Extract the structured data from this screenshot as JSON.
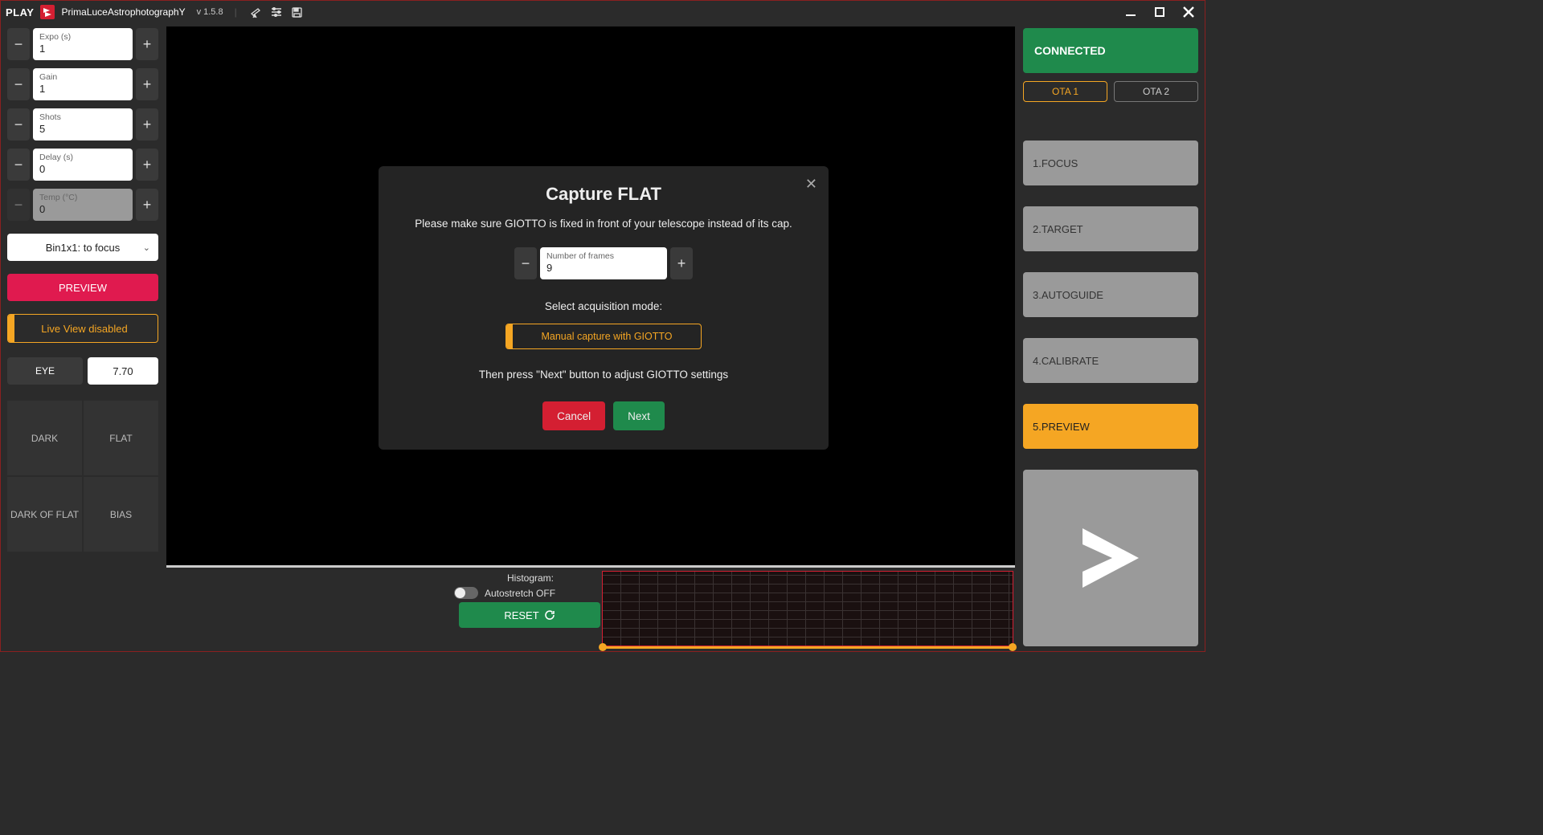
{
  "titlebar": {
    "play": "PLAY",
    "app_name": "PrimaLuceAstrophotographY",
    "version": "v 1.5.8"
  },
  "left": {
    "steppers": [
      {
        "label": "Expo (s)",
        "value": "1"
      },
      {
        "label": "Gain",
        "value": "1"
      },
      {
        "label": "Shots",
        "value": "5"
      },
      {
        "label": "Delay (s)",
        "value": "0"
      },
      {
        "label": "Temp (°C)",
        "value": "0",
        "disabled": true
      }
    ],
    "binning": "Bin1x1: to focus",
    "preview_btn": "PREVIEW",
    "liveview": "Live View disabled",
    "eye_label": "EYE",
    "eye_value": "7.70",
    "cal": [
      "DARK",
      "FLAT",
      "DARK OF FLAT",
      "BIAS"
    ]
  },
  "histogram": {
    "title": "Histogram:",
    "autostretch": "Autostretch OFF",
    "reset": "RESET"
  },
  "right": {
    "connected": "CONNECTED",
    "ota1": "OTA 1",
    "ota2": "OTA 2",
    "steps": [
      {
        "label": "1.FOCUS"
      },
      {
        "label": "2.TARGET"
      },
      {
        "label": "3.AUTOGUIDE"
      },
      {
        "label": "4.CALIBRATE"
      },
      {
        "label": "5.PREVIEW",
        "active": true
      }
    ]
  },
  "modal": {
    "title": "Capture FLAT",
    "desc": "Please make sure GIOTTO is fixed in front of your telescope instead of its cap.",
    "frames_label": "Number of frames",
    "frames_value": "9",
    "mode_title": "Select acquisition mode:",
    "mode_btn": "Manual capture with GIOTTO",
    "instr": "Then press \"Next\" button to adjust GIOTTO settings",
    "cancel": "Cancel",
    "next": "Next"
  }
}
